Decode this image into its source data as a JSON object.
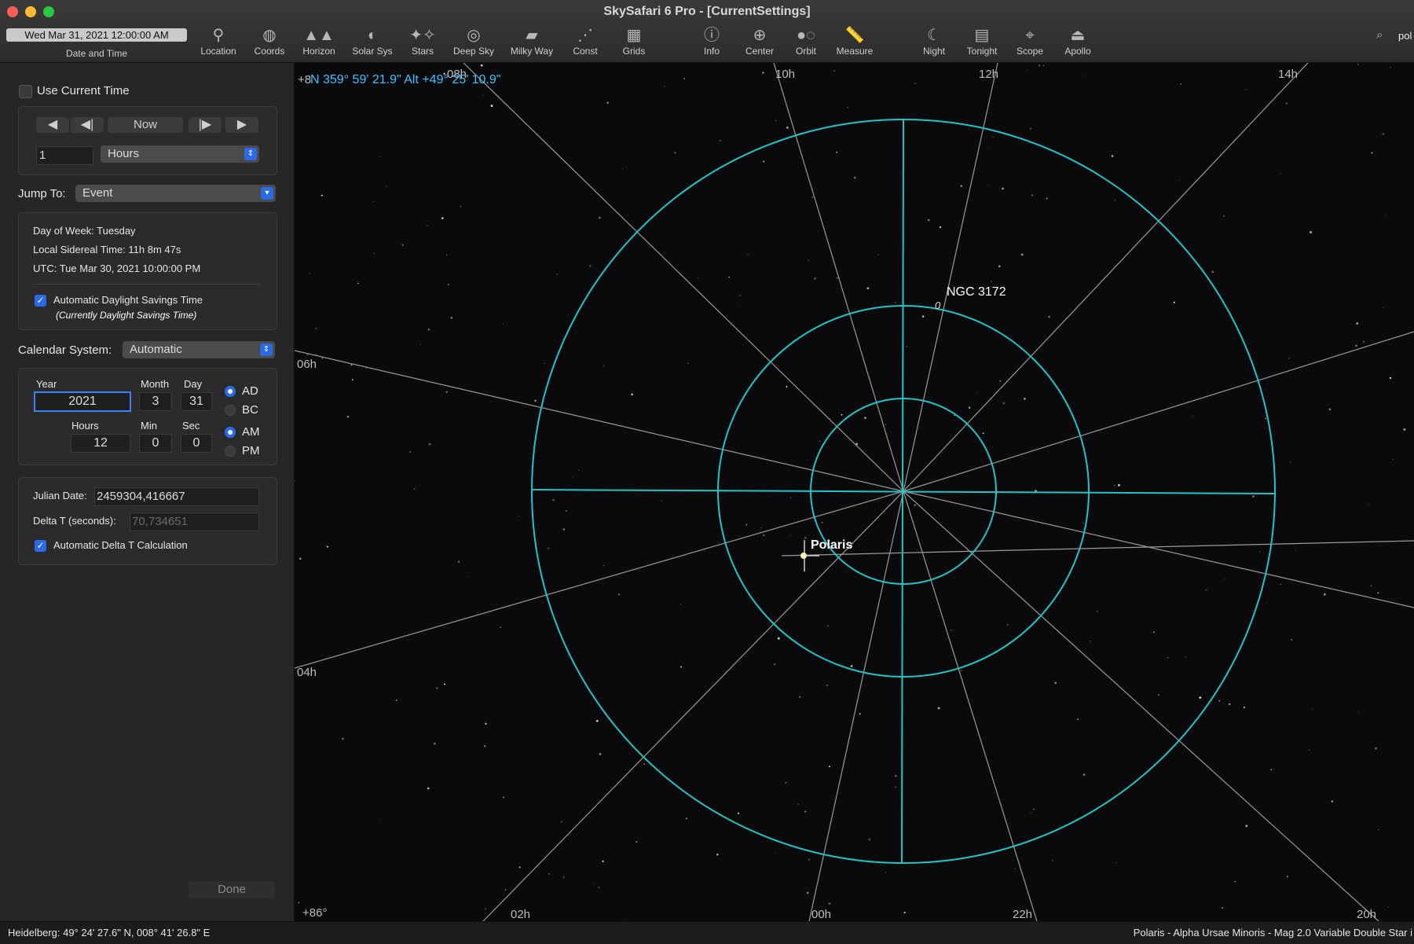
{
  "window": {
    "title": "SkySafari 6 Pro - [CurrentSettings]"
  },
  "toolbar": {
    "date_value": "Wed Mar 31, 2021  12:00:00 AM",
    "date_caption": "Date and Time",
    "items": [
      {
        "label": "Location",
        "icon": "location-pin-icon"
      },
      {
        "label": "Coords",
        "icon": "coords-icon"
      },
      {
        "label": "Horizon",
        "icon": "horizon-icon"
      },
      {
        "label": "Solar Sys",
        "icon": "planet-icon"
      },
      {
        "label": "Stars",
        "icon": "stars-icon"
      },
      {
        "label": "Deep Sky",
        "icon": "galaxy-icon"
      },
      {
        "label": "Milky Way",
        "icon": "milky-way-icon"
      },
      {
        "label": "Const",
        "icon": "constellation-icon"
      },
      {
        "label": "Grids",
        "icon": "grid-icon"
      },
      {
        "label": "Info",
        "icon": "info-icon"
      },
      {
        "label": "Center",
        "icon": "crosshair-icon"
      },
      {
        "label": "Orbit",
        "icon": "orbit-icon"
      },
      {
        "label": "Measure",
        "icon": "ruler-icon"
      },
      {
        "label": "Night",
        "icon": "moon-icon"
      },
      {
        "label": "Tonight",
        "icon": "calendar-icon"
      },
      {
        "label": "Scope",
        "icon": "telescope-icon"
      },
      {
        "label": "Apollo",
        "icon": "lander-icon"
      }
    ],
    "search_value": "pol"
  },
  "sidebar": {
    "use_current_time": "Use Current Time",
    "step": {
      "now": "Now",
      "amount": "1",
      "unit": "Hours"
    },
    "jump_to": {
      "label": "Jump To:",
      "value": "Event"
    },
    "info": {
      "day_of_week": "Day of Week:  Tuesday",
      "sidereal": "Local Sidereal Time:  11h 8m 47s",
      "utc": "UTC:  Tue Mar 30, 2021  10:00:00 PM",
      "auto_dst": "Automatic Daylight Savings Time",
      "dst_note": "(Currently Daylight Savings Time)"
    },
    "calendar": {
      "label": "Calendar System:",
      "value": "Automatic"
    },
    "date": {
      "year_label": "Year",
      "year": "2021",
      "month_label": "Month",
      "month": "3",
      "day_label": "Day",
      "day": "31",
      "hours_label": "Hours",
      "hours": "12",
      "min_label": "Min",
      "min": "0",
      "sec_label": "Sec",
      "sec": "0",
      "ad": "AD",
      "bc": "BC",
      "am": "AM",
      "pm": "PM"
    },
    "julian": {
      "label": "Julian Date:",
      "value": "2459304,416667",
      "delta_label": "Delta T (seconds):",
      "delta_value": "70,734651",
      "auto_delta": "Automatic Delta T Calculation"
    },
    "done": "Done"
  },
  "sky": {
    "readout": "N 359° 59' 21.9\"  Alt +49° 25' 10.9\"",
    "readout_prefix": "+8",
    "ra_labels": [
      "08h",
      "10h",
      "12h",
      "14h",
      "06h",
      "04h",
      "02h",
      "00h",
      "22h",
      "20h"
    ],
    "dec_label": "+86°",
    "objects": {
      "polaris": "Polaris",
      "ngc": "NGC 3172",
      "ngc_mark": "0"
    },
    "grid_color": "#22c4c4",
    "line_color": "#9a9a9a"
  },
  "statusbar": {
    "location": "Heidelberg: 49° 24' 27.6\" N, 008° 41' 26.8\" E",
    "object": "Polaris - Alpha Ursae Minoris - Mag 2.0 Variable Double Star i"
  }
}
